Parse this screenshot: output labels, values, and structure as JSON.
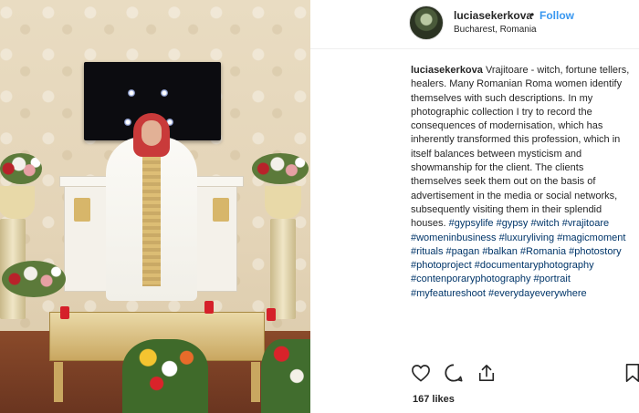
{
  "post": {
    "username": "luciasekerkova",
    "separator": "•",
    "follow_label": "Follow",
    "location": "Bucharest, Romania",
    "caption_author": "luciasekerkova",
    "caption_text": "Vrajitoare - witch, fortune tellers, healers. Many Romanian Roma women identify themselves with such descriptions. In my photographic collection I try to record the consequences of modernisation, which has inherently transformed this profession, which in itself balances between mysticism and showmanship for the client. The clients themselves seek them out on the basis of advertisement in the media or social networks, subsequently visiting them in their splendid houses.",
    "hashtags": [
      "#gypsylife",
      "#gypsy",
      "#witch",
      "#vrajitoare",
      "#womeninbusiness",
      "#luxuryliving",
      "#magicmoment",
      "#rituals",
      "#pagan",
      "#balkan",
      "#Romania",
      "#photostory",
      "#photoproject",
      "#documentaryphotography",
      "#contenporaryphotography",
      "#portrait",
      "#myfeatureshoot",
      "#everydayeverywhere"
    ],
    "likes": "167 likes"
  },
  "icons": {
    "like": "heart-icon",
    "comment": "comment-icon",
    "share": "share-icon",
    "save": "bookmark-icon"
  },
  "colors": {
    "link": "#3897f0",
    "hashtag": "#003569",
    "text": "#262626"
  }
}
